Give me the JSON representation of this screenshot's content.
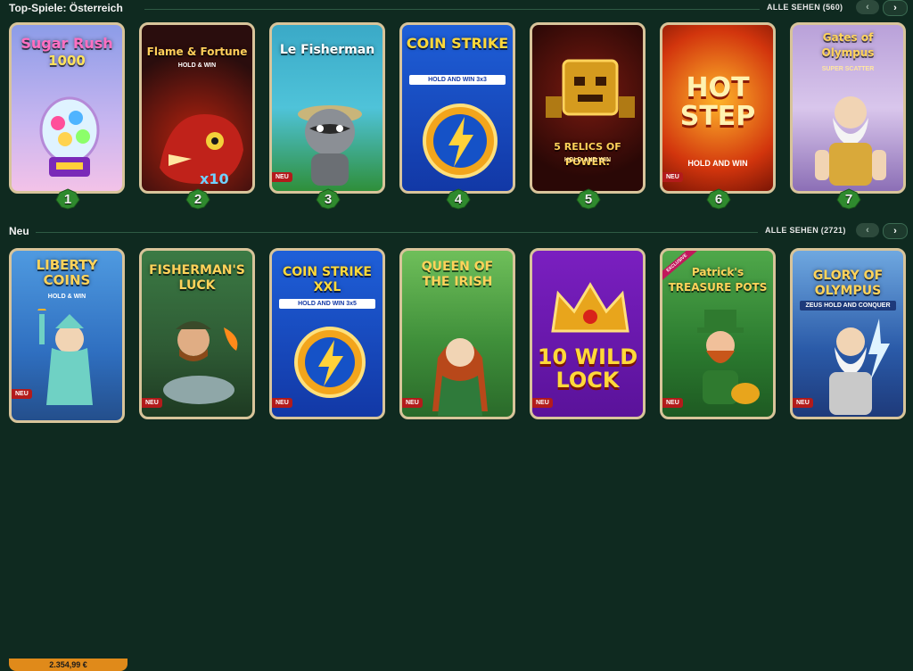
{
  "sections": {
    "top": {
      "title": "Top-Spiele: Österreich",
      "see_all": "ALLE SEHEN (560)"
    },
    "new": {
      "title": "Neu",
      "see_all": "ALLE SEHEN (2721)"
    }
  },
  "nav": {
    "prev": "‹",
    "next": "›"
  },
  "top_games": [
    {
      "title": "Sugar Rush",
      "sub": "1000",
      "rank": "1",
      "badge": "",
      "bg": "#9fa6e8"
    },
    {
      "title": "Flame & Fortune",
      "sub": "HOLD & WIN",
      "rank": "2",
      "badge": "",
      "bg": "#2a0d0d"
    },
    {
      "title": "Le Fisherman",
      "sub": "",
      "rank": "3",
      "badge": "NEU",
      "bg": "#3aa9c7"
    },
    {
      "title": "COIN STRIKE",
      "sub": "HOLD AND WIN 3x3",
      "rank": "4",
      "badge": "",
      "bg": "#1546b8"
    },
    {
      "title": "5 RELICS OF POWER:",
      "sub": "HOLD AND WIN",
      "rank": "5",
      "badge": "",
      "bg": "#3d0b08"
    },
    {
      "title": "HOT STEP",
      "sub": "HOLD AND WIN",
      "rank": "6",
      "badge": "NEU",
      "bg": "#d2350d"
    },
    {
      "title": "Gates of Olympus",
      "sub": "SUPER SCATTER",
      "rank": "7",
      "badge": "",
      "bg": "#b9a1d9"
    }
  ],
  "new_games": [
    {
      "title": "LIBERTY COINS",
      "sub": "HOLD & WIN",
      "badge": "NEU",
      "bg": "#3d7fd0",
      "jackpot": "2.354,99 €"
    },
    {
      "title": "FISHERMAN'S LUCK",
      "sub": "",
      "badge": "NEU",
      "bg": "#2e5a34"
    },
    {
      "title": "COIN STRIKE XXL",
      "sub": "HOLD AND WIN 3x5",
      "badge": "NEU",
      "bg": "#1238a6"
    },
    {
      "title": "QUEEN OF THE IRISH",
      "sub": "",
      "badge": "NEU",
      "bg": "#3f8f3a"
    },
    {
      "title": "10 WILD LOCK",
      "sub": "",
      "badge": "NEU",
      "bg": "#6a1aa6"
    },
    {
      "title": "Patrick's TREASURE POTS",
      "sub": "",
      "badge": "NEU",
      "bg": "#2b7a2f",
      "exclusive": "EXCLUSIVE"
    },
    {
      "title": "GLORY OF OLYMPUS",
      "sub": "ZEUS HOLD AND CONQUER",
      "badge": "NEU",
      "bg": "#2a5aa8"
    }
  ],
  "colors": {
    "background": "#0f2a20",
    "card_border": "#d8c49a",
    "badge_red": "#b31b1b",
    "rank_leaf": "#2f8a2e"
  }
}
